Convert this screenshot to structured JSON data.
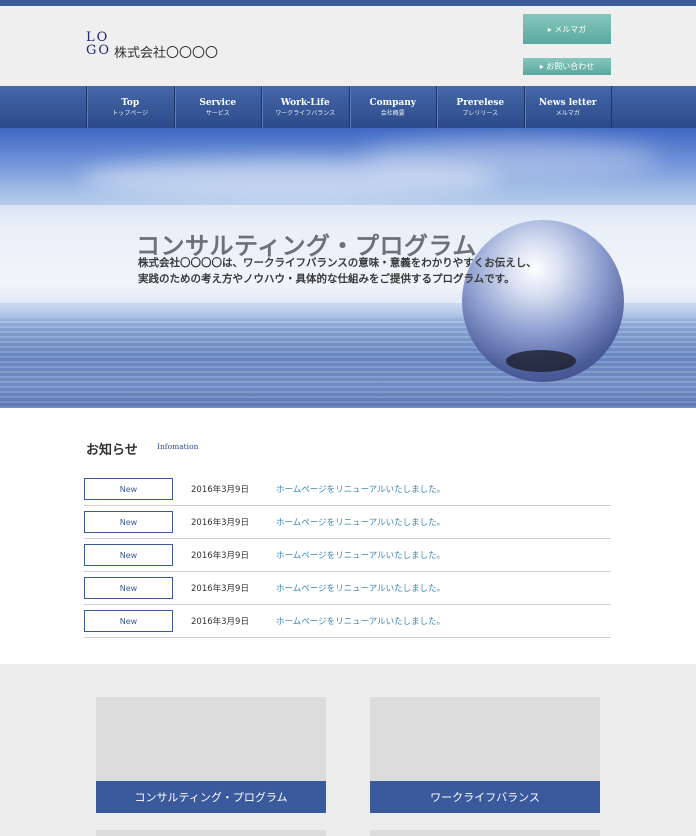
{
  "header": {
    "logo_line1": "LO",
    "logo_line2": "GO",
    "company_name": "株式会社〇〇〇〇",
    "mailmag_button": "▸ メルマガ",
    "contact_button": "▸ お問い合わせ"
  },
  "nav": {
    "items": [
      {
        "en": "Top",
        "jp": "トップページ"
      },
      {
        "en": "Service",
        "jp": "サービス"
      },
      {
        "en": "Work-Life",
        "jp": "ワークライフバランス"
      },
      {
        "en": "Company",
        "jp": "会社概要"
      },
      {
        "en": "Prerelese",
        "jp": "プレリリース"
      },
      {
        "en": "News letter",
        "jp": "メルマガ"
      }
    ]
  },
  "hero": {
    "title": "コンサルティング・プログラム",
    "subtitle_line1": "株式会社〇〇〇〇は、ワークライフバランスの意味・意義をわかりやすくお伝えし、",
    "subtitle_line2": "実践のための考え方やノウハウ・具体的な仕組みをご提供するプログラムです。"
  },
  "news": {
    "title": "お知らせ",
    "subtitle": "Infomation",
    "items": [
      {
        "badge": "New",
        "date": "2016年3月9日",
        "text": "ホームページをリニューアルいたしました。"
      },
      {
        "badge": "New",
        "date": "2016年3月9日",
        "text": "ホームページをリニューアルいたしました。"
      },
      {
        "badge": "New",
        "date": "2016年3月9日",
        "text": "ホームページをリニューアルいたしました。"
      },
      {
        "badge": "New",
        "date": "2016年3月9日",
        "text": "ホームページをリニューアルいたしました。"
      },
      {
        "badge": "New",
        "date": "2016年3月9日",
        "text": "ホームページをリニューアルいたしました。"
      }
    ]
  },
  "cards": [
    {
      "label": "コンサルティング・プログラム"
    },
    {
      "label": "ワークライフバランス"
    }
  ],
  "colors": {
    "accent": "#3c5a9a",
    "button_teal": "#6fb5aa",
    "link": "#3a86b6"
  }
}
